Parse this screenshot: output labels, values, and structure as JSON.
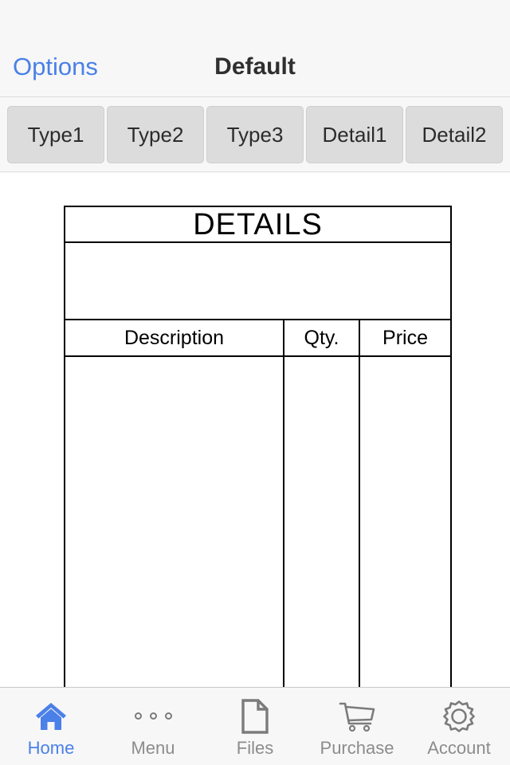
{
  "app": {
    "screen_name": "Default",
    "background": "#f7f7f7",
    "content_background": "#ffffff",
    "accent_color": "#4a80e8",
    "muted_color": "#8c8c8c"
  },
  "status_bar": {
    "items": []
  },
  "nav": {
    "back_label": "Options",
    "title": "Default"
  },
  "segments": {
    "items": [
      {
        "label": "Type1",
        "name": "segment-type1"
      },
      {
        "label": "Type2",
        "name": "segment-type2"
      },
      {
        "label": "Type3",
        "name": "segment-type3"
      },
      {
        "label": "Detail1",
        "name": "segment-detail1"
      },
      {
        "label": "Detail2",
        "name": "segment-detail2"
      }
    ]
  },
  "invoice": {
    "title": "DETAILS",
    "meta_row": "",
    "columns": [
      {
        "label": "Description",
        "name": "column-header-description"
      },
      {
        "label": "Qty.",
        "name": "column-header-qty"
      },
      {
        "label": "Price",
        "name": "column-header-price"
      }
    ],
    "rows": []
  },
  "tab_bar": {
    "items": [
      {
        "label": "Home",
        "icon": "home-icon",
        "active": true
      },
      {
        "label": "Menu",
        "icon": "dots-icon",
        "active": false
      },
      {
        "label": "Files",
        "icon": "document-icon",
        "active": false
      },
      {
        "label": "Purchase",
        "icon": "cart-icon",
        "active": false
      },
      {
        "label": "Account",
        "icon": "gear-icon",
        "active": false
      }
    ]
  }
}
